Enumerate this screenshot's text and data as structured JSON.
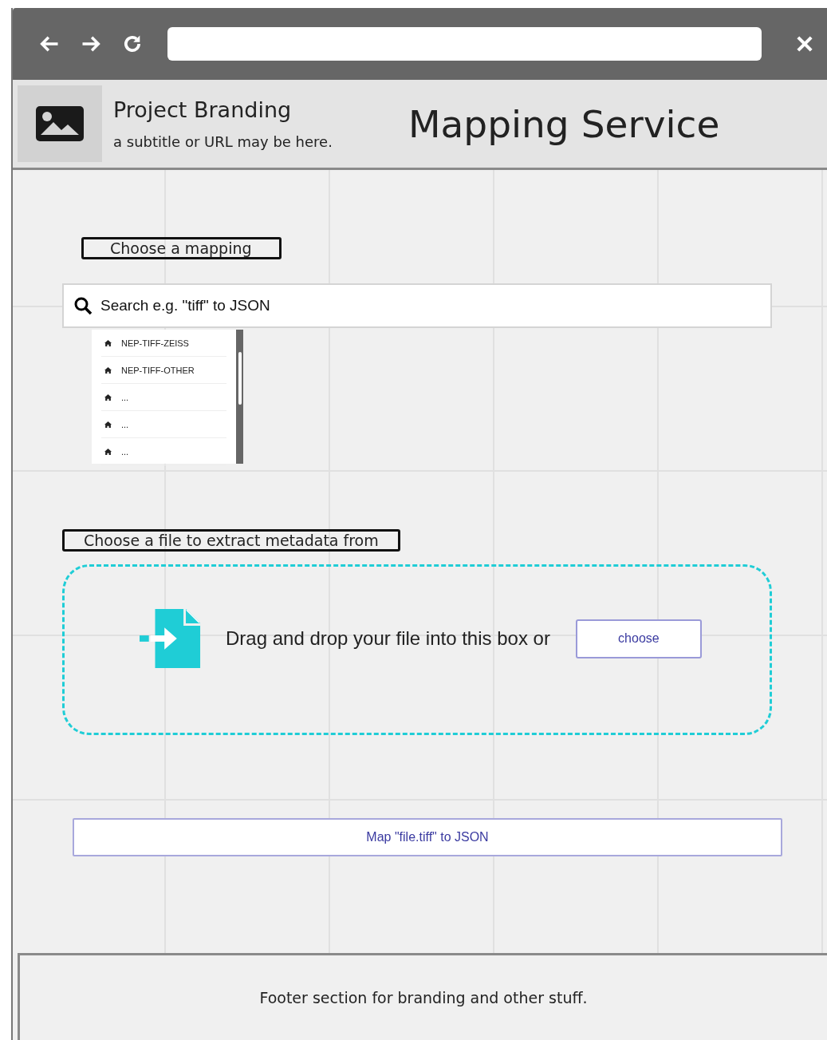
{
  "header": {
    "brand": "Project Branding",
    "subtitle": "a subtitle or URL may be here.",
    "title": "Mapping Service"
  },
  "mapping": {
    "label": "Choose a mapping",
    "search": {
      "value": "Search e.g. \"tiff\" to JSON"
    },
    "items": [
      "NEP-TIFF-ZEISS",
      "NEP-TIFF-OTHER",
      "...",
      "...",
      "..."
    ]
  },
  "file": {
    "label": "Choose a file to extract metadata from",
    "prompt": "Drag and drop your file into this box or",
    "button": "choose"
  },
  "map_button": "Map \"file.tiff\" to JSON",
  "footer": "Footer section for branding and other stuff."
}
